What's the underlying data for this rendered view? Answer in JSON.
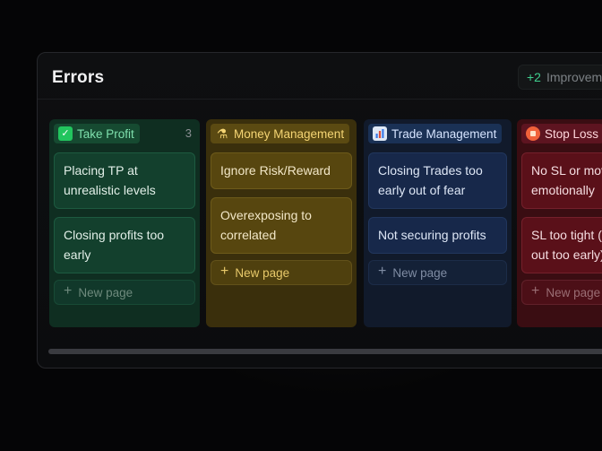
{
  "page": {
    "title": "Errors"
  },
  "badge": {
    "count": "+2",
    "label": "Improvements"
  },
  "columns": [
    {
      "name": "Take Profit",
      "icon": "check-icon",
      "count": "3",
      "cards": [
        "Placing TP at unrealistic levels",
        "Closing profits too early"
      ],
      "new_page_label": "New page"
    },
    {
      "name": "Money Management",
      "icon": "money-bag-icon",
      "cards": [
        "Ignore Risk/Reward",
        "Overexposing to correlated"
      ],
      "new_page_label": "New page"
    },
    {
      "name": "Trade Management",
      "icon": "bar-chart-icon",
      "cards": [
        "Closing Trades too early out of fear",
        "Not securing profits"
      ],
      "new_page_label": "New page"
    },
    {
      "name": "Stop Loss",
      "icon": "stop-icon",
      "cards": [
        "No SL or moving SL emotionally",
        "SL too tight (stopped out too early)"
      ],
      "new_page_label": "New page"
    }
  ],
  "colors": {
    "green": "#0f2e21",
    "yellow": "#3a2f0c",
    "blue": "#111a2b",
    "red": "#3a0d12",
    "accent_green": "#3fcf8e"
  }
}
